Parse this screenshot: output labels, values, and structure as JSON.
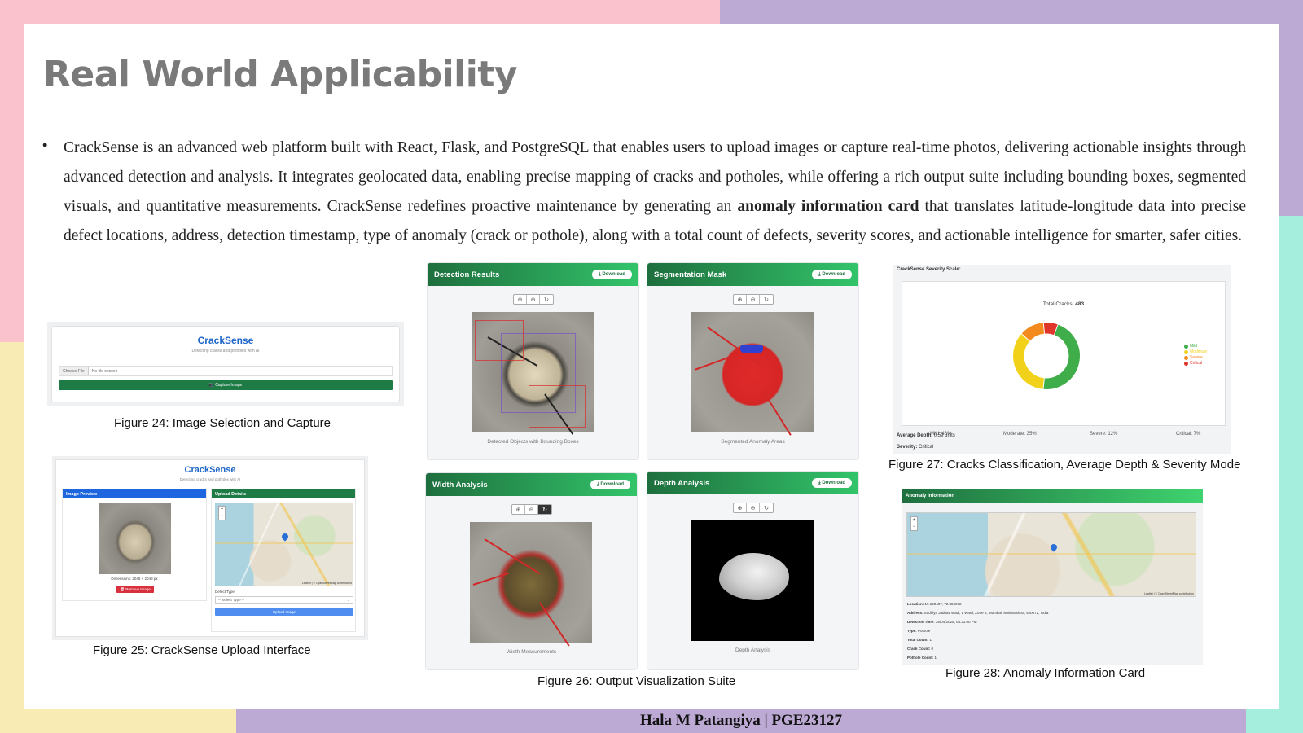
{
  "slide": {
    "title": "Real World Applicability",
    "bullet_part1": "CrackSense is an advanced web platform built with React, Flask, and PostgreSQL that enables users to upload images or capture real-time photos, delivering actionable insights through advanced detection and analysis. It integrates geolocated data, enabling precise mapping of cracks and potholes, while offering a rich output suite including bounding boxes, segmented visuals, and quantitative measurements. CrackSense redefines proactive maintenance by generating an ",
    "bullet_bold": "anomaly information card",
    "bullet_part2": " that translates latitude-longitude data into precise defect locations, address, detection timestamp, type of anomaly (crack or pothole), along with a total count of defects, severity scores, and actionable intelligence for smarter, safer cities.",
    "footer": "Hala M Patangiya | PGE23127"
  },
  "fig24": {
    "caption": "Figure 24: Image Selection and Capture",
    "brand": "CrackSense",
    "tagline": "Detecting cracks and potholes with AI",
    "choose_file": "Choose File",
    "no_file": "No file chosen",
    "capture_label": "📷 Capture Image"
  },
  "fig25": {
    "caption": "Figure 25: CrackSense Upload Interface",
    "brand": "CrackSense",
    "tagline": "Detecting cracks and potholes with AI",
    "image_preview": "Image Preview",
    "upload_details": "Upload Details",
    "dimensions": "Dimensions: 2048 × 2048 px",
    "remove_image": "🗑 Remove Image",
    "defect_type": "Defect Type:",
    "select_type": "-- Select Type --",
    "upload_image": "Upload Image",
    "map_credit": "Leaflet | © OpenStreetMap contributors"
  },
  "fig26": {
    "caption": "Figure 26: Output Visualization Suite",
    "download": "⤓ Download",
    "zoom_in": "⊕",
    "zoom_out": "⊖",
    "reset": "↻",
    "cards": [
      {
        "title": "Detection Results",
        "label": "Detected Objects with Bounding Boxes"
      },
      {
        "title": "Segmentation Mask",
        "label": "Segmented Anomaly Areas"
      },
      {
        "title": "Width Analysis",
        "label": "Width Measurements"
      },
      {
        "title": "Depth Analysis",
        "label": "Depth Analysis"
      }
    ]
  },
  "fig27": {
    "caption": "Figure 27: Cracks Classification, Average Depth & Severity Mode",
    "scale_title": "CrackSense Severity Scale:",
    "total_label": "Total Cracks:",
    "total_value": "483",
    "average_depth_label": "Average Depth:",
    "average_depth_value": "0.59 units",
    "severity_label": "Severity:",
    "severity_value": "Critical",
    "percent_labels": [
      "Mild: 46%",
      "Moderate: 35%",
      "Severe: 12%",
      "Critical: 7%"
    ]
  },
  "chart_data": {
    "type": "pie",
    "categories": [
      "Mild",
      "Moderate",
      "Severe",
      "Critical"
    ],
    "values": [
      46,
      35,
      12,
      7
    ],
    "colors": [
      "#3fae4a",
      "#f2d11b",
      "#f28a1e",
      "#e0352b"
    ]
  },
  "fig28": {
    "caption": "Figure 28: Anomaly Information Card",
    "header": "Anomaly Information",
    "map_credit": "Leaflet | © OpenStreetMap contributors",
    "location_label": "Location:",
    "location_value": "19.120487, 72.886962",
    "address_label": "Address:",
    "address_value": "Sudhiya Jadhav Wadi, L Ward, Zone 5, Mumbai, Maharashtra, 400072, India",
    "time_label": "Detection Time:",
    "time_value": "26/04/2025, 04:31:00 PM",
    "type_label": "Type:",
    "type_value": "Pothole",
    "total_label": "Total Count:",
    "total_value": "1",
    "crack_label": "Crack Count:",
    "crack_value": "0",
    "pothole_label": "Pothole Count:",
    "pothole_value": "1"
  }
}
